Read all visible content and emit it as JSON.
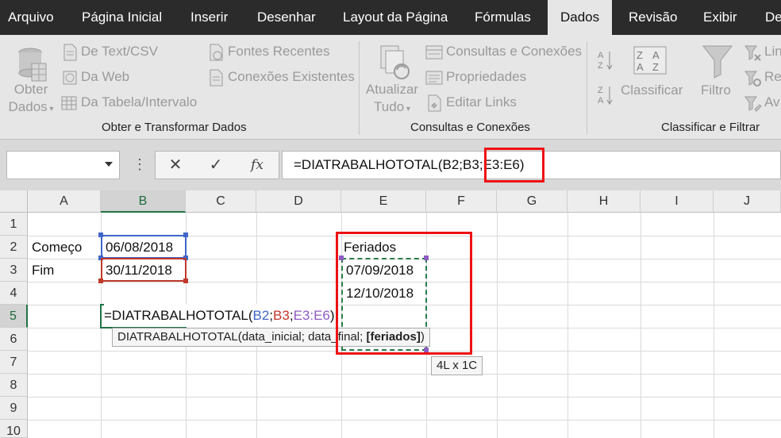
{
  "menu": {
    "tabs": [
      {
        "label": "Arquivo"
      },
      {
        "label": "Página Inicial"
      },
      {
        "label": "Inserir"
      },
      {
        "label": "Desenhar"
      },
      {
        "label": "Layout da Página"
      },
      {
        "label": "Fórmulas"
      },
      {
        "label": "Dados"
      },
      {
        "label": "Revisão"
      },
      {
        "label": "Exibir"
      },
      {
        "label": "De"
      }
    ],
    "active": "Dados"
  },
  "ribbon": {
    "get_data": {
      "obter_line1": "Obter",
      "obter_line2": "Dados",
      "text_csv": "De Text/CSV",
      "web": "Da Web",
      "table_range": "Da Tabela/Intervalo",
      "recent_sources": "Fontes Recentes",
      "existing_connections": "Conexões Existentes",
      "group_label": "Obter e Transformar Dados"
    },
    "queries": {
      "refresh_line1": "Atualizar",
      "refresh_line2": "Tudo",
      "queries_connections": "Consultas e Conexões",
      "properties": "Propriedades",
      "edit_links": "Editar Links",
      "group_label": "Consultas e Conexões"
    },
    "sort_filter": {
      "sort": "Classificar",
      "filter": "Filtro",
      "clear_partial": "Lin",
      "reapply_partial": "Re",
      "advanced_partial": "Av",
      "group_label": "Classificar e Filtrar"
    }
  },
  "formula_bar": {
    "name_box": "",
    "dots": "⋮",
    "cancel": "✕",
    "enter": "✓",
    "fx": "fx",
    "formula": "=DIATRABALHOTOTAL(B2;B3;E3:E6)"
  },
  "grid": {
    "columns": [
      "A",
      "B",
      "C",
      "D",
      "E",
      "F",
      "G",
      "H",
      "I",
      "J"
    ],
    "rows": [
      "1",
      "2",
      "3",
      "4",
      "5",
      "6",
      "7",
      "8",
      "9",
      "10"
    ],
    "selected_column": "B",
    "selected_row": "5",
    "cells": {
      "A2": "Começo",
      "B2": "06/08/2018",
      "A3": "Fim",
      "B3": "30/11/2018",
      "E2": "Feriados",
      "E3": "07/09/2018",
      "E4": "12/10/2018"
    },
    "edit_formula": {
      "prefix": "=DIATRABALHOTOTAL(",
      "ref1": "B2",
      "sep1": ";",
      "ref2": "B3",
      "sep2": ";",
      "ref3": "E3:E6",
      "suffix": ")"
    },
    "function_tooltip": {
      "prefix": "DIATRABALHOTOTAL(data_inicial; data_final; ",
      "bold_arg": "[feriados]",
      "suffix": ")"
    },
    "size_tooltip": "4L x 1C"
  },
  "colors": {
    "ref1": "#3f66c8",
    "ref2": "#c0392b",
    "ref3": "#8e5bc2",
    "highlight": "#ee1111",
    "selection": "#217346",
    "menubar": "#2b2b2b",
    "ribbon": "#e6e6e6"
  }
}
